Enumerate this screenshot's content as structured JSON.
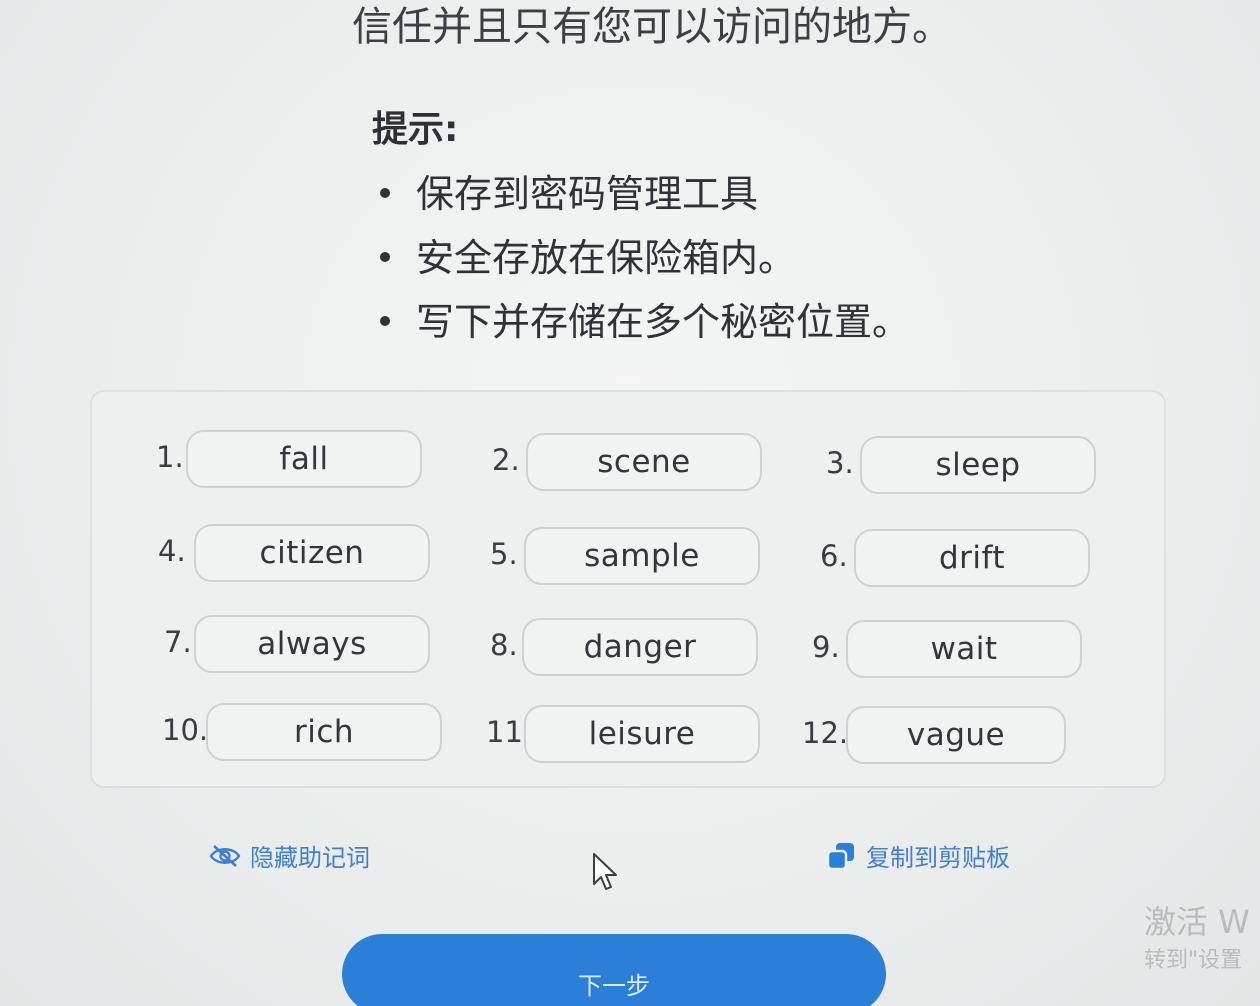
{
  "intro": {
    "text": "信任并且只有您可以访问的地方。"
  },
  "tips": {
    "heading": "提示:",
    "items": [
      "保存到密码管理工具",
      "安全存放在保险箱内。",
      "写下并存储在多个秘密位置。"
    ]
  },
  "phrase": {
    "words": [
      {
        "num": "1.",
        "word": "fall"
      },
      {
        "num": "2.",
        "word": "scene"
      },
      {
        "num": "3.",
        "word": "sleep"
      },
      {
        "num": "4.",
        "word": "citizen"
      },
      {
        "num": "5.",
        "word": "sample"
      },
      {
        "num": "6.",
        "word": "drift"
      },
      {
        "num": "7.",
        "word": "always"
      },
      {
        "num": "8.",
        "word": "danger"
      },
      {
        "num": "9.",
        "word": "wait"
      },
      {
        "num": "10.",
        "word": "rich"
      },
      {
        "num": "11.",
        "word": "leisure"
      },
      {
        "num": "12.",
        "word": "vague"
      }
    ]
  },
  "actions": {
    "hide_label": "隐藏助记词",
    "hide_icon": "eye-slash-icon",
    "copy_label": "复制到剪贴板",
    "copy_icon": "copy-icon",
    "next_label": "下一步"
  },
  "watermark": {
    "title": "激活 W",
    "subtitle": "转到\"设置"
  },
  "colors": {
    "accent": "#2b7fd6",
    "link": "#3f7fd0",
    "background": "#eceeee"
  }
}
